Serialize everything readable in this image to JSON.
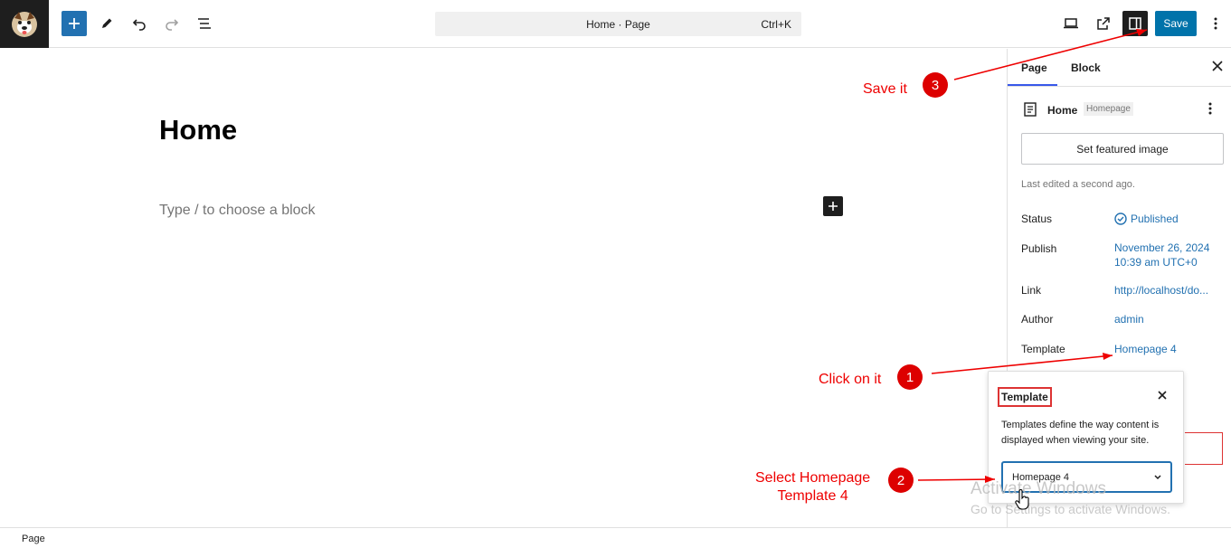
{
  "toolbar": {
    "command_title": "Home · Page",
    "command_shortcut": "Ctrl+K",
    "save_label": "Save"
  },
  "editor": {
    "title": "Home",
    "placeholder": "Type / to choose a block"
  },
  "sidebar": {
    "tabs": [
      "Page",
      "Block"
    ],
    "doc_title": "Home",
    "doc_badge": "Homepage",
    "featured_label": "Set featured image",
    "last_edited": "Last edited a second ago.",
    "rows": {
      "status_label": "Status",
      "status_value": "Published",
      "publish_label": "Publish",
      "publish_date": "November 26, 2024",
      "publish_time": "10:39 am UTC+0",
      "link_label": "Link",
      "link_value": "http://localhost/do...",
      "author_label": "Author",
      "author_value": "admin",
      "template_label": "Template",
      "template_value": "Homepage 4"
    }
  },
  "popover": {
    "title": "Template",
    "desc": "Templates define the way content is displayed when viewing your site.",
    "selected": "Homepage 4"
  },
  "footer": {
    "breadcrumb": "Page"
  },
  "annotations": {
    "step1_text": "Click on it",
    "step1_num": "1",
    "step2_line1": "Select Homepage",
    "step2_line2": "Template 4",
    "step2_num": "2",
    "step3_text": "Save it",
    "step3_num": "3"
  },
  "watermark": {
    "line1": "Activate Windows",
    "line2": "Go to Settings to activate Windows."
  },
  "colors": {
    "accent": "#2271b1",
    "save": "#0073aa",
    "annotation": "#e00000"
  }
}
